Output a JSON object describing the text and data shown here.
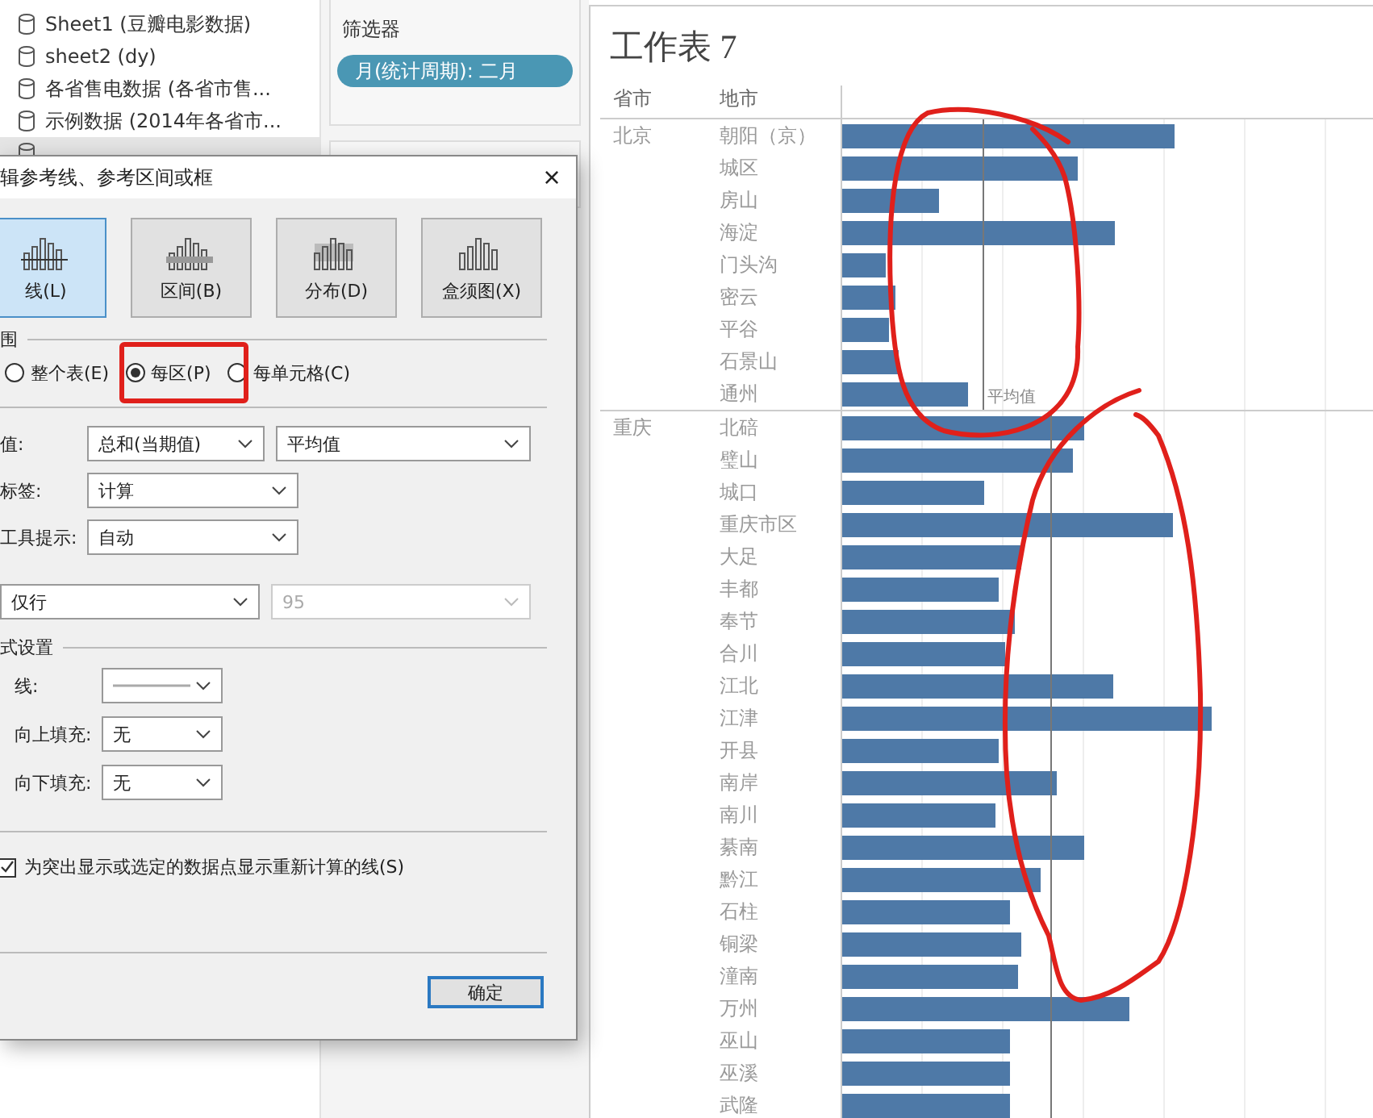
{
  "sidebar": {
    "items": [
      {
        "label": "Sheet1 (豆瓣电影数据)",
        "selected": false
      },
      {
        "label": "sheet2 (dy)",
        "selected": false
      },
      {
        "label": "各省售电数据 (各省市售...",
        "selected": false
      },
      {
        "label": "示例数据 (2014年各省市...",
        "selected": false
      },
      {
        "selected": true
      }
    ]
  },
  "filters": {
    "title": "筛选器",
    "pills": [
      "月(统计周期): 二月"
    ]
  },
  "worksheet": {
    "title": "工作表 7",
    "columns": [
      "省市",
      "地市"
    ],
    "groups": [
      {
        "name": "北京",
        "cities": [
          "朝阳（京）",
          "城区",
          "房山",
          "海淀",
          "门头沟",
          "密云",
          "平谷",
          "石景山",
          "通州"
        ],
        "reference_label": "平均值"
      },
      {
        "name": "重庆",
        "cities": [
          "北碚",
          "璧山",
          "城口",
          "重庆市区",
          "大足",
          "丰都",
          "奉节",
          "合川",
          "江北",
          "江津",
          "开县",
          "南岸",
          "南川",
          "綦南",
          "黔江",
          "石柱",
          "铜梁",
          "潼南",
          "万州",
          "巫山",
          "巫溪",
          "武隆"
        ]
      }
    ]
  },
  "dialog": {
    "title": "辑参考线、参考区间或框",
    "close": "×",
    "types": [
      {
        "label": "线(L)",
        "selected": true
      },
      {
        "label": "区间(B)",
        "selected": false
      },
      {
        "label": "分布(D)",
        "selected": false
      },
      {
        "label": "盒须图(X)",
        "selected": false
      }
    ],
    "scope": {
      "title": "围",
      "options": [
        {
          "label": "整个表(E)",
          "selected": false
        },
        {
          "label": "每区(P)",
          "selected": true
        },
        {
          "label": "每单元格(C)",
          "selected": false
        }
      ]
    },
    "value": {
      "label": "值:",
      "aggregation": "总和(当期值)",
      "function": "平均值"
    },
    "label": {
      "label": "标签:",
      "value": "计算"
    },
    "tooltip": {
      "label": "工具提示:",
      "value": "自动"
    },
    "confidence": {
      "value": "仅行",
      "level": "95",
      "level_disabled": true
    },
    "format": {
      "title": "式设置",
      "line_label": "线:",
      "fills": [
        {
          "label": "向上填充:",
          "value": "无"
        },
        {
          "label": "向下填充:",
          "value": "无"
        }
      ]
    },
    "recalc": {
      "label": "为突出显示或选定的数据点显示重新计算的线(S)",
      "checked": true
    },
    "ok_button": "确定"
  }
}
